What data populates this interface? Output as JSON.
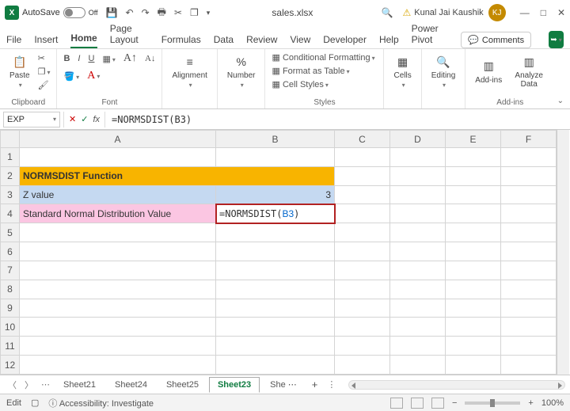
{
  "titlebar": {
    "autosave": "AutoSave",
    "autosave_state": "Off",
    "filename": "sales.xlsx",
    "user_name": "Kunal Jai Kaushik",
    "user_initials": "KJ"
  },
  "tabs": {
    "file": "File",
    "insert": "Insert",
    "home": "Home",
    "page": "Page Layout",
    "formulas": "Formulas",
    "data": "Data",
    "review": "Review",
    "view": "View",
    "developer": "Developer",
    "help": "Help",
    "power": "Power Pivot",
    "comments": "Comments"
  },
  "ribbon": {
    "clipboard": {
      "paste": "Paste",
      "label": "Clipboard"
    },
    "font": {
      "bold": "B",
      "italic": "I",
      "underline": "U",
      "label": "Font"
    },
    "alignment": {
      "btn": "Alignment"
    },
    "number": {
      "btn": "Number"
    },
    "styles": {
      "cond": "Conditional Formatting",
      "table": "Format as Table",
      "cell": "Cell Styles",
      "label": "Styles"
    },
    "cells": {
      "btn": "Cells"
    },
    "editing": {
      "btn": "Editing"
    },
    "addins": {
      "btn": "Add-ins",
      "analyze": "Analyze Data",
      "label": "Add-ins"
    }
  },
  "formula_bar": {
    "namebox": "EXP",
    "formula": "=NORMSDIST(B3)"
  },
  "columns": [
    "A",
    "B",
    "C",
    "D",
    "E",
    "F"
  ],
  "rows": [
    "1",
    "2",
    "3",
    "4",
    "5",
    "6",
    "7",
    "8",
    "9",
    "10",
    "11",
    "12"
  ],
  "cells": {
    "title": "NORMSDIST Function",
    "a3": "Z value",
    "b3": "3",
    "a4": "Standard Normal Distribution Value",
    "b4": "=NORMSDIST(B3)"
  },
  "sheets": {
    "s21": "Sheet21",
    "s24": "Sheet24",
    "s25": "Sheet25",
    "s23": "Sheet23",
    "more": "She"
  },
  "status": {
    "mode": "Edit",
    "access": "Accessibility: Investigate",
    "zoom": "100%"
  }
}
